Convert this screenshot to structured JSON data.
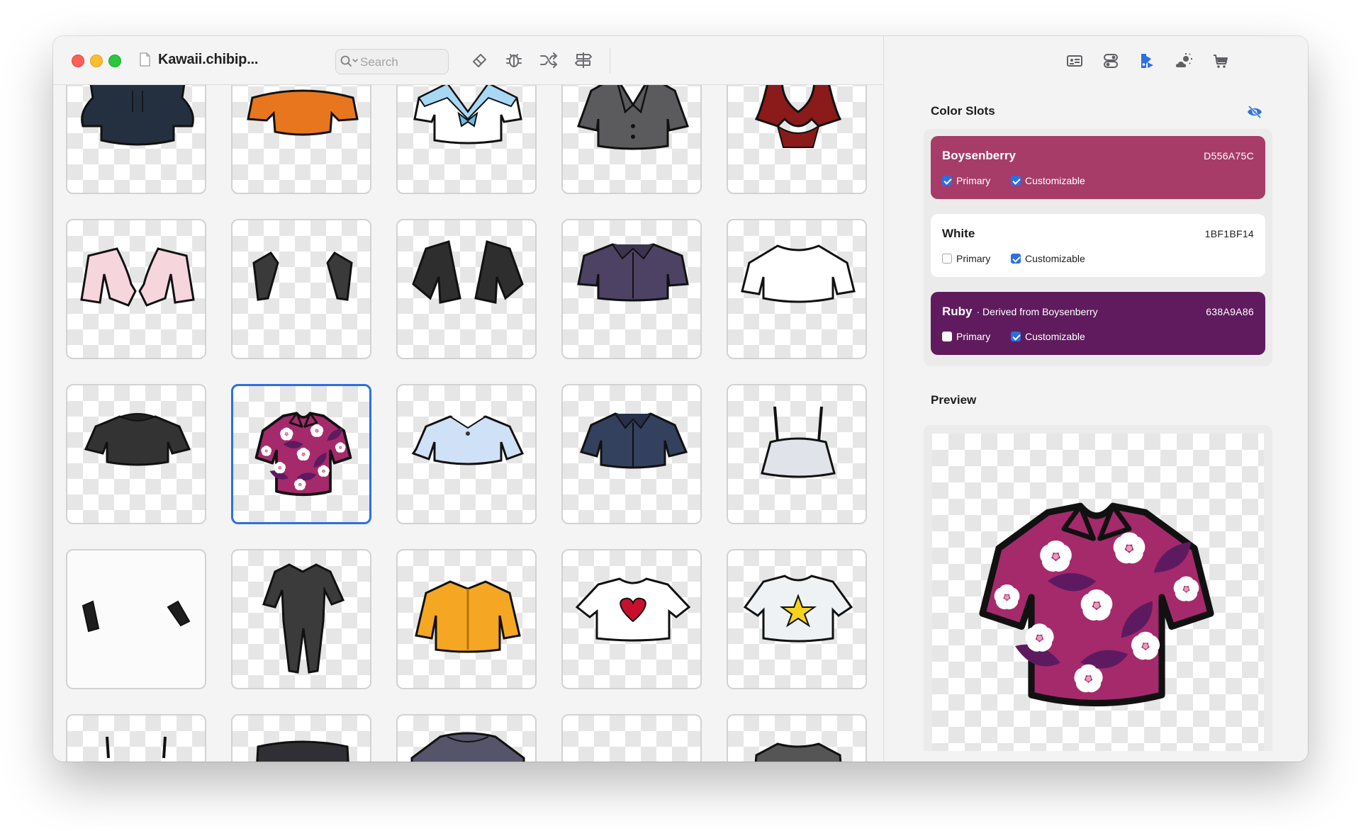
{
  "window": {
    "title": "Kawaii.chibip..."
  },
  "toolbar": {
    "search_placeholder": "Search",
    "icons": [
      "eraser-icon",
      "bug-icon",
      "shuffle-icon",
      "signpost-icon"
    ]
  },
  "inspector_tabs": [
    "id-card-icon",
    "toggles-icon",
    "paint-icon",
    "weather-icon",
    "cart-icon"
  ],
  "color_slots": {
    "heading": "Color Slots",
    "visibility_icon": "eye-slash-icon",
    "slots": [
      {
        "name": "Boysenberry",
        "derived": "",
        "hex": "D556A75C",
        "primary": true,
        "customizable": true,
        "color": "#a73c69",
        "primary_label": "Primary",
        "customizable_label": "Customizable"
      },
      {
        "name": "White",
        "derived": "",
        "hex": "1BF1BF14",
        "primary": false,
        "customizable": true,
        "color": "#ffffff",
        "primary_label": "Primary",
        "customizable_label": "Customizable"
      },
      {
        "name": "Ruby",
        "derived": "· Derived from Boysenberry",
        "hex": "638A9A86",
        "primary": false,
        "customizable": true,
        "color": "#5f1b5e",
        "primary_label": "Primary",
        "customizable_label": "Customizable"
      }
    ]
  },
  "preview": {
    "heading": "Preview",
    "item": "hawaiian-shirt"
  },
  "grid": {
    "selected_index": 11,
    "items": [
      {
        "name": "navy-hoodie",
        "color": "#24303f"
      },
      {
        "name": "orange-off-shoulder-top",
        "color": "#e8761f"
      },
      {
        "name": "sailor-uniform-top",
        "color": "#ffffff"
      },
      {
        "name": "grey-blazer",
        "color": "#5b5b5d"
      },
      {
        "name": "red-hood-collar",
        "color": "#8b1a1a"
      },
      {
        "name": "pink-bolero",
        "color": "#f7d5dd"
      },
      {
        "name": "black-sleeves",
        "color": "#3a3a3a"
      },
      {
        "name": "black-leather-jacket",
        "color": "#2e2e2e"
      },
      {
        "name": "purple-shirt",
        "color": "#4d4263"
      },
      {
        "name": "white-long-sleeve",
        "color": "#ffffff"
      },
      {
        "name": "black-sweater",
        "color": "#333333"
      },
      {
        "name": "hawaiian-shirt",
        "color": "#a52a6b"
      },
      {
        "name": "light-blue-blouse",
        "color": "#cfe1f6"
      },
      {
        "name": "navy-button-shirt",
        "color": "#33405e"
      },
      {
        "name": "white-cami-top",
        "color": "#e1e3ea"
      },
      {
        "name": "black-cuffs",
        "color": "#1e1e1e"
      },
      {
        "name": "black-bodysuit",
        "color": "#3b3b3b"
      },
      {
        "name": "yellow-jacket",
        "color": "#f5a623"
      },
      {
        "name": "heart-tshirt",
        "color": "#ffffff"
      },
      {
        "name": "star-tshirt",
        "color": "#eef2f4"
      },
      {
        "name": "strap-top-partial",
        "color": "#2b2b2b"
      },
      {
        "name": "black-top-partial",
        "color": "#2f2f35"
      },
      {
        "name": "grey-sweater-partial",
        "color": "#55546a"
      },
      {
        "name": "empty-partial",
        "color": "#ffffff"
      },
      {
        "name": "grey-tee-partial",
        "color": "#555555"
      }
    ]
  }
}
